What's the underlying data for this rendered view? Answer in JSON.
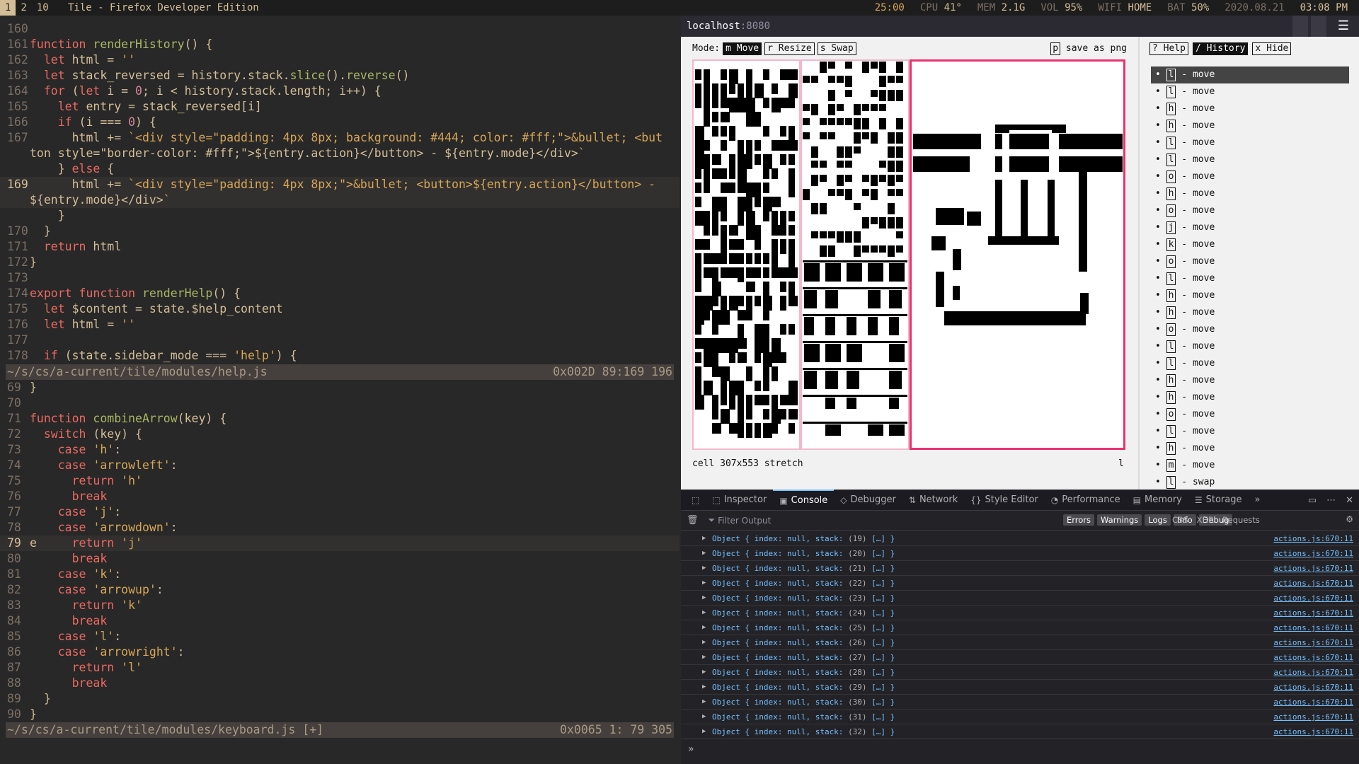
{
  "topbar": {
    "workspaces": [
      "1",
      "2",
      "10"
    ],
    "window_title": "Tile - Firefox Developer Edition",
    "timer": "25:00",
    "cpu_label": "CPU",
    "cpu": "41°",
    "mem_label": "MEM",
    "mem": "2.1G",
    "vol_label": "VOL",
    "vol": "95%",
    "wifi_label": "WIFI",
    "wifi": "HOME",
    "bat_label": "BAT",
    "bat": "50%",
    "date": "2020.08.21",
    "time": "03:08 PM"
  },
  "editor_top": {
    "lines": [
      {
        "n": "160",
        "t": ""
      },
      {
        "n": "161",
        "t": "function renderHistory() {"
      },
      {
        "n": "162",
        "t": "  let html = ''"
      },
      {
        "n": "163",
        "t": "  let stack_reversed = history.stack.slice().reverse()"
      },
      {
        "n": "164",
        "t": "  for (let i = 0; i < history.stack.length; i++) {"
      },
      {
        "n": "165",
        "t": "    let entry = stack_reversed[i]"
      },
      {
        "n": "166",
        "t": "    if (i === 0) {"
      },
      {
        "n": "167",
        "t": "      html += `<div style=\"padding: 4px 8px; background: #444; color: #fff;\">&bullet; <but"
      },
      {
        "n": "",
        "t": "ton style=\"border-color: #fff;\">${entry.action}</button> - ${entry.mode}</div>`"
      },
      {
        "n": "",
        "t": "    } else {"
      },
      {
        "n": "169",
        "t": "      html += `<div style=\"padding: 4px 8px;\">&bullet; <button>${entry.action}</button> -"
      },
      {
        "n": "",
        "t": "${entry.mode}</div>`"
      },
      {
        "n": "",
        "t": "    }"
      },
      {
        "n": "170",
        "t": "  }"
      },
      {
        "n": "171",
        "t": "  return html"
      },
      {
        "n": "172",
        "t": "}"
      },
      {
        "n": "173",
        "t": ""
      },
      {
        "n": "174",
        "t": "export function renderHelp() {"
      },
      {
        "n": "175",
        "t": "  let $content = state.$help_content"
      },
      {
        "n": "176",
        "t": "  let html = ''"
      },
      {
        "n": "177",
        "t": ""
      },
      {
        "n": "178",
        "t": "  if (state.sidebar_mode === 'help') {"
      }
    ],
    "modeline_file": "~/s/cs/a-current/tile/modules/help.js",
    "modeline_pos": "0x002D 89:169 196"
  },
  "editor_bottom": {
    "lines": [
      {
        "n": "69",
        "t": "}"
      },
      {
        "n": "70",
        "t": ""
      },
      {
        "n": "71",
        "t": "function combineArrow(key) {"
      },
      {
        "n": "72",
        "t": "  switch (key) {"
      },
      {
        "n": "73",
        "t": "    case 'h':"
      },
      {
        "n": "74",
        "t": "    case 'arrowleft':"
      },
      {
        "n": "75",
        "t": "      return 'h'"
      },
      {
        "n": "76",
        "t": "      break"
      },
      {
        "n": "77",
        "t": "    case 'j':"
      },
      {
        "n": "78",
        "t": "    case 'arrowdown':"
      },
      {
        "n": "79",
        "t": "e     return 'j'"
      },
      {
        "n": "80",
        "t": "      break"
      },
      {
        "n": "81",
        "t": "    case 'k':"
      },
      {
        "n": "82",
        "t": "    case 'arrowup':"
      },
      {
        "n": "83",
        "t": "      return 'k'"
      },
      {
        "n": "84",
        "t": "      break"
      },
      {
        "n": "85",
        "t": "    case 'l':"
      },
      {
        "n": "86",
        "t": "    case 'arrowright':"
      },
      {
        "n": "87",
        "t": "      return 'l'"
      },
      {
        "n": "88",
        "t": "      break"
      },
      {
        "n": "89",
        "t": "  }"
      },
      {
        "n": "90",
        "t": "}"
      }
    ],
    "modeline_file": "~/s/cs/a-current/tile/modules/keyboard.js [+]",
    "modeline_pos": "0x0065  1: 79 305"
  },
  "browser": {
    "url_host": "localhost",
    "url_port": ":8080",
    "menu_icon": "hamburger-icon"
  },
  "app": {
    "mode_label": "Mode:",
    "modes": [
      {
        "key": "m",
        "label": "Move",
        "active": true
      },
      {
        "key": "r",
        "label": "Resize",
        "active": false
      },
      {
        "key": "s",
        "label": "Swap",
        "active": false
      }
    ],
    "save_key": "p",
    "save_label": "save as png",
    "status": "cell 307x553 stretch",
    "status_right": "l",
    "sidebar_buttons": [
      {
        "key": "?",
        "label": "Help"
      },
      {
        "key": "/",
        "label": "History",
        "active": true
      },
      {
        "key": "x",
        "label": "Hide"
      }
    ],
    "history": [
      {
        "action": "l",
        "mode": "move"
      },
      {
        "action": "l",
        "mode": "move"
      },
      {
        "action": "h",
        "mode": "move"
      },
      {
        "action": "h",
        "mode": "move"
      },
      {
        "action": "l",
        "mode": "move"
      },
      {
        "action": "l",
        "mode": "move"
      },
      {
        "action": "o",
        "mode": "move"
      },
      {
        "action": "h",
        "mode": "move"
      },
      {
        "action": "o",
        "mode": "move"
      },
      {
        "action": "j",
        "mode": "move"
      },
      {
        "action": "k",
        "mode": "move"
      },
      {
        "action": "o",
        "mode": "move"
      },
      {
        "action": "l",
        "mode": "move"
      },
      {
        "action": "h",
        "mode": "move"
      },
      {
        "action": "h",
        "mode": "move"
      },
      {
        "action": "o",
        "mode": "move"
      },
      {
        "action": "l",
        "mode": "move"
      },
      {
        "action": "l",
        "mode": "move"
      },
      {
        "action": "h",
        "mode": "move"
      },
      {
        "action": "h",
        "mode": "move"
      },
      {
        "action": "o",
        "mode": "move"
      },
      {
        "action": "l",
        "mode": "move"
      },
      {
        "action": "h",
        "mode": "move"
      },
      {
        "action": "m",
        "mode": "move"
      },
      {
        "action": "l",
        "mode": "swap"
      }
    ],
    "selection_color": "#e8326e"
  },
  "devtools": {
    "tabs": [
      {
        "icon": "inspector-icon",
        "label": "Inspector"
      },
      {
        "icon": "console-icon",
        "label": "Console",
        "active": true
      },
      {
        "icon": "debugger-icon",
        "label": "Debugger"
      },
      {
        "icon": "network-icon",
        "label": "Network"
      },
      {
        "icon": "style-editor-icon",
        "label": "Style Editor"
      },
      {
        "icon": "performance-icon",
        "label": "Performance"
      },
      {
        "icon": "memory-icon",
        "label": "Memory"
      },
      {
        "icon": "storage-icon",
        "label": "Storage"
      }
    ],
    "filter_placeholder": "Filter Output",
    "filter_chips": [
      "Errors",
      "Warnings",
      "Logs",
      "Info",
      "Debug"
    ],
    "filter_plain": [
      "CSS",
      "XHR",
      "Requests"
    ],
    "log": [
      {
        "count": "(19)"
      },
      {
        "count": "(20)"
      },
      {
        "count": "(21)"
      },
      {
        "count": "(22)"
      },
      {
        "count": "(23)"
      },
      {
        "count": "(24)"
      },
      {
        "count": "(25)"
      },
      {
        "count": "(26)"
      },
      {
        "count": "(27)"
      },
      {
        "count": "(28)"
      },
      {
        "count": "(29)"
      },
      {
        "count": "(30)"
      },
      {
        "count": "(31)"
      },
      {
        "count": "(32)"
      }
    ],
    "log_prefix": "Object { index: null, stack: ",
    "log_suffix": " […] }",
    "log_source": "actions.js:670:11"
  }
}
